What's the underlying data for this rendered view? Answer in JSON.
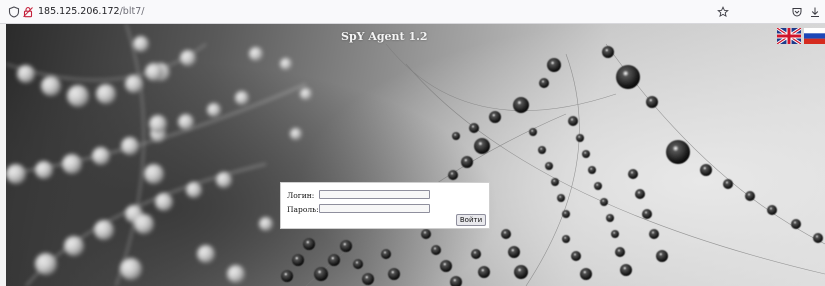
{
  "browser": {
    "url_host": "185.125.206.172",
    "url_path": "/blt7/"
  },
  "header": {
    "title": "SpY Agent 1.2"
  },
  "languages": [
    {
      "name": "English",
      "icon": "uk-flag-icon"
    },
    {
      "name": "Russian",
      "icon": "russia-flag-icon"
    }
  ],
  "login": {
    "login_label": "Логин:",
    "login_value": "",
    "password_label": "Пароль:",
    "password_value": "",
    "submit_label": "Войти"
  },
  "colors": {
    "page_bg_dark": "#2b2b2b",
    "page_bg_light": "#dadada",
    "title_color": "#f4f4f4"
  }
}
